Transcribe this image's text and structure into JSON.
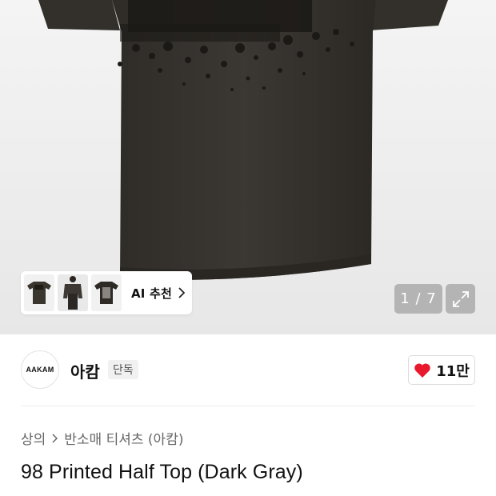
{
  "gallery": {
    "ai_recommend_label": "AI 추천",
    "counter": "1 / 7",
    "thumbnails": [
      "shirt-thumb-1",
      "model-thumb-2",
      "shirt-thumb-3"
    ]
  },
  "brand": {
    "logo_text": "AAKAM",
    "name": "아캄",
    "badge": "단독"
  },
  "like": {
    "count": "11만",
    "color": "#e8192c"
  },
  "breadcrumb": {
    "items": [
      "상의",
      "반소매 티셔츠 (아캄)"
    ]
  },
  "product": {
    "title": "98 Printed Half Top (Dark Gray)",
    "shirt_color": "#3a3631"
  }
}
